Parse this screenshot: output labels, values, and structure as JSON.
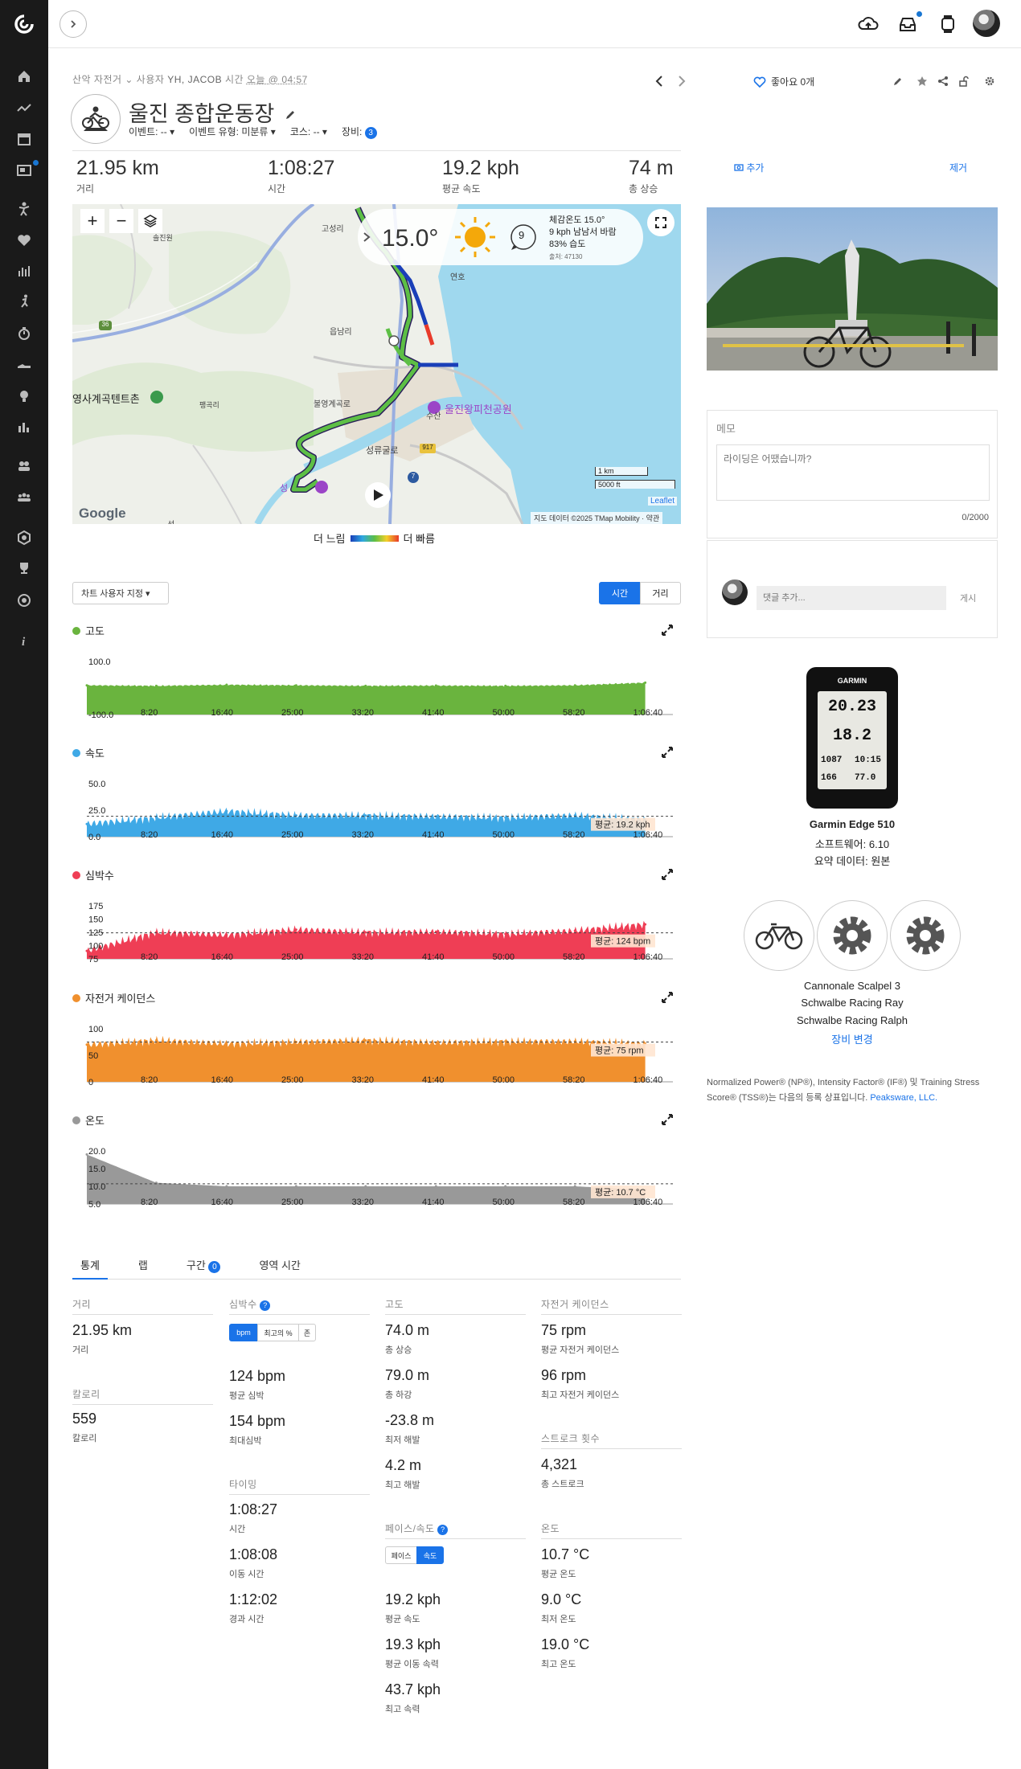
{
  "header": {
    "sport": "산악 자전거",
    "user_label": "사용자",
    "user_name": "YH, JACOB",
    "time_label": "시간",
    "time_value": "오늘 @ 04:57",
    "title": "울진 종합운동장",
    "event_label": "이벤트: --",
    "event_type_label": "이벤트 유형: 미분류",
    "course_label": "코스: --",
    "gear_label": "장비:",
    "gear_count": "3",
    "likes": "좋아요 0개"
  },
  "summary": [
    {
      "value": "21.95 km",
      "label": "거리"
    },
    {
      "value": "1:08:27",
      "label": "시간"
    },
    {
      "value": "19.2 kph",
      "label": "평균 속도"
    },
    {
      "value": "74 m",
      "label": "총 상승"
    }
  ],
  "map": {
    "temperature": "15.0°",
    "wind_number": "9",
    "feels_like": "체감온도 15.0°",
    "wind": "9 kph 남남서 바람",
    "humidity": "83% 습도",
    "station": "출처: 47130",
    "scale_km": "1 km",
    "scale_ft": "5000 ft",
    "attribution": "지도 데이터 ©2025 TMap Mobility · 약관",
    "leaflet": "Leaflet",
    "google": "Google",
    "labels": {
      "park": "울진왕피천공원",
      "camp": "영사계곡텐트촌",
      "road_36": "36",
      "road_7": "7",
      "road_917": "917",
      "village1": "고성리",
      "village2": "읍남리",
      "village3": "수산",
      "village4": "성류굴로",
      "village5": "연호",
      "village6": "불영계곡로",
      "village7": "솔진원",
      "village8": "팽곡리",
      "village9": "성",
      "village10": "선"
    }
  },
  "legend": {
    "slow": "더 느림",
    "fast": "더 빠름"
  },
  "chart_controls": {
    "customize": "차트 사용자 지정 ▾",
    "time": "시간",
    "distance": "거리"
  },
  "x_ticks": [
    "8:20",
    "16:40",
    "25:00",
    "33:20",
    "41:40",
    "50:00",
    "58:20",
    "1:06:40"
  ],
  "chart_data": [
    {
      "type": "area",
      "title": "고도",
      "color": "#6ab43e",
      "ylim": [
        -100,
        100
      ],
      "y_ticks": [
        "100.0",
        "-100.0"
      ],
      "x": [
        0,
        8.3,
        16.7,
        25.0,
        33.3,
        41.7,
        50.0,
        58.3,
        66.7
      ],
      "values": [
        10,
        8,
        12,
        10,
        8,
        9,
        8,
        10,
        20
      ]
    },
    {
      "type": "area",
      "title": "속도",
      "color": "#3fa9e6",
      "ylim": [
        0,
        50
      ],
      "y_ticks": [
        "50.0",
        "25.0",
        "0.0"
      ],
      "average_label": "평균: 19.2 kph",
      "average": 19.2,
      "x": [
        0,
        8.3,
        16.7,
        25.0,
        33.3,
        41.7,
        50.0,
        58.3,
        66.7
      ],
      "values": [
        12,
        18,
        24,
        20,
        20,
        19,
        18,
        20,
        16
      ]
    },
    {
      "type": "area",
      "title": "심박수",
      "color": "#ef3e55",
      "ylim": [
        75,
        175
      ],
      "y_ticks": [
        "175",
        "150",
        "125",
        "100",
        "75"
      ],
      "average_label": "평균: 124 bpm",
      "average": 124,
      "x": [
        0,
        8.3,
        16.7,
        25.0,
        33.3,
        41.7,
        50.0,
        58.3,
        66.7
      ],
      "values": [
        90,
        125,
        120,
        130,
        125,
        126,
        122,
        128,
        140
      ]
    },
    {
      "type": "area",
      "title": "자전거 케이던스",
      "color": "#f0902e",
      "ylim": [
        0,
        100
      ],
      "y_ticks": [
        "100",
        "50",
        "0"
      ],
      "average_label": "평균: 75 rpm",
      "average": 75,
      "x": [
        0,
        8.3,
        16.7,
        25.0,
        33.3,
        41.7,
        50.0,
        58.3,
        66.7
      ],
      "values": [
        70,
        78,
        72,
        75,
        78,
        74,
        76,
        76,
        72
      ]
    },
    {
      "type": "area",
      "title": "온도",
      "color": "#999999",
      "ylim": [
        5,
        20
      ],
      "y_ticks": [
        "20.0",
        "15.0",
        "10.0",
        "5.0"
      ],
      "average_label": "평균: 10.7 °C",
      "average": 10.7,
      "x": [
        0,
        8.3,
        16.7,
        25.0,
        33.3,
        41.7,
        50.0,
        58.3,
        66.7
      ],
      "values": [
        19,
        11,
        10,
        10,
        10,
        10,
        10,
        10,
        9
      ]
    }
  ],
  "tabs": [
    "통계",
    "랩",
    "구간",
    "영역 시간"
  ],
  "segment_count": "0",
  "stats": {
    "distance": {
      "title": "거리",
      "value": "21.95 km",
      "label": "거리"
    },
    "calories": {
      "title": "칼로리",
      "value": "559",
      "label": "칼로리"
    },
    "heart_rate": {
      "title": "심박수",
      "seg": [
        "bpm",
        "최고의 %",
        "존"
      ],
      "avg": "124 bpm",
      "avg_label": "평균 심박",
      "max": "154 bpm",
      "max_label": "최대심박"
    },
    "timing": {
      "title": "타이밍",
      "time": "1:08:27",
      "time_label": "시간",
      "moving": "1:08:08",
      "moving_label": "이동 시간",
      "elapsed": "1:12:02",
      "elapsed_label": "경과 시간"
    },
    "elevation": {
      "title": "고도",
      "gain": "74.0 m",
      "gain_label": "총 상승",
      "loss": "79.0 m",
      "loss_label": "총 하강",
      "min": "-23.8 m",
      "min_label": "최저 해발",
      "max": "4.2 m",
      "max_label": "최고 해발"
    },
    "pace": {
      "title": "페이스/속도",
      "seg": [
        "페이스",
        "속도"
      ],
      "avg": "19.2 kph",
      "avg_label": "평균 속도",
      "moving": "19.3 kph",
      "moving_label": "평균 이동 속력",
      "max": "43.7 kph",
      "max_label": "최고 속력"
    },
    "cadence": {
      "title": "자전거 케이던스",
      "avg": "75 rpm",
      "avg_label": "평균 자전거 케이던스",
      "max": "96 rpm",
      "max_label": "최고 자전거 케이던스"
    },
    "strokes": {
      "title": "스트로크 횟수",
      "value": "4,321",
      "label": "총 스트로크"
    },
    "temperature": {
      "title": "온도",
      "avg": "10.7 °C",
      "avg_label": "평균 온도",
      "min": "9.0 °C",
      "min_label": "최저 온도",
      "max": "19.0 °C",
      "max_label": "최고 온도"
    }
  },
  "right": {
    "add": "추가",
    "remove": "제거",
    "memo_title": "메모",
    "memo_placeholder": "라이딩은 어땠습니까?",
    "memo_count": "0/2000",
    "comment_placeholder": "댓글 추가...",
    "comment_post": "게시",
    "device_name": "Garmin Edge 510",
    "software": "소프트웨어: 6.10",
    "summary_data": "요약 데이터: 원본",
    "device_screen": {
      "brand": "GARMIN",
      "dist": "20.23",
      "speed": "18.2",
      "elev": "1087",
      "tod": "10:15",
      "hr": "166",
      "temp": "77.0"
    },
    "gear": [
      "Cannonale Scalpel 3",
      "Schwalbe Racing Ray",
      "Schwalbe Racing Ralph"
    ],
    "gear_change": "장비 변경",
    "footnote": "Normalized Power® (NP®), Intensity Factor® (IF®) 및 Training Stress Score® (TSS®)는 다음의 등록 상표입니다.",
    "footnote_link": "Peaksware, LLC."
  },
  "colors": {
    "accent": "#1a73e8",
    "sidebar": "#1a1a1a"
  }
}
